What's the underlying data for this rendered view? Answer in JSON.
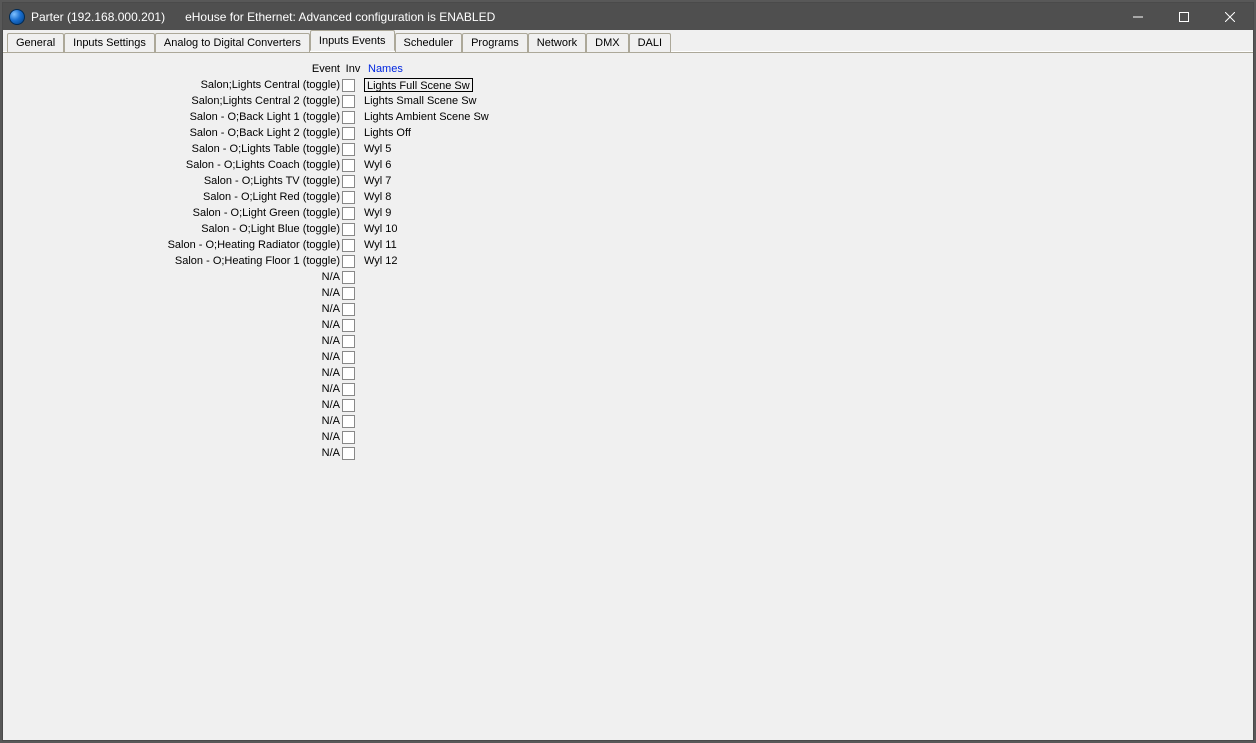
{
  "window": {
    "title": "Parter (192.168.000.201)      eHouse for Ethernet: Advanced configuration is ENABLED"
  },
  "tabs": [
    "General",
    "Inputs Settings",
    "Analog to Digital Converters",
    "Inputs Events",
    "Scheduler",
    "Programs",
    "Network",
    "DMX",
    "DALI"
  ],
  "active_tab_index": 3,
  "headers": {
    "event": "Event",
    "inv": "Inv",
    "names": "Names"
  },
  "rows": [
    {
      "event": "Salon;Lights Central (toggle)",
      "inv": false,
      "name": "Lights Full Scene Sw",
      "edit": true
    },
    {
      "event": "Salon;Lights Central 2 (toggle)",
      "inv": false,
      "name": "Lights Small Scene Sw",
      "edit": false
    },
    {
      "event": "Salon - O;Back Light 1 (toggle)",
      "inv": false,
      "name": "Lights Ambient Scene Sw",
      "edit": false
    },
    {
      "event": "Salon - O;Back Light 2 (toggle)",
      "inv": false,
      "name": "Lights Off",
      "edit": false
    },
    {
      "event": "Salon - O;Lights Table (toggle)",
      "inv": false,
      "name": "Wyl 5",
      "edit": false
    },
    {
      "event": "Salon - O;Lights Coach (toggle)",
      "inv": false,
      "name": "Wyl 6",
      "edit": false
    },
    {
      "event": "Salon - O;Lights TV (toggle)",
      "inv": false,
      "name": "Wyl 7",
      "edit": false
    },
    {
      "event": "Salon - O;Light Red (toggle)",
      "inv": false,
      "name": "Wyl 8",
      "edit": false
    },
    {
      "event": "Salon - O;Light Green (toggle)",
      "inv": false,
      "name": "Wyl 9",
      "edit": false
    },
    {
      "event": "Salon - O;Light Blue (toggle)",
      "inv": false,
      "name": "Wyl 10",
      "edit": false
    },
    {
      "event": "Salon - O;Heating Radiator (toggle)",
      "inv": false,
      "name": "Wyl 11",
      "edit": false
    },
    {
      "event": "Salon - O;Heating Floor 1 (toggle)",
      "inv": false,
      "name": "Wyl 12",
      "edit": false
    },
    {
      "event": "N/A",
      "inv": false,
      "name": "",
      "edit": false
    },
    {
      "event": "N/A",
      "inv": false,
      "name": "",
      "edit": false
    },
    {
      "event": "N/A",
      "inv": false,
      "name": "",
      "edit": false
    },
    {
      "event": "N/A",
      "inv": false,
      "name": "",
      "edit": false
    },
    {
      "event": "N/A",
      "inv": false,
      "name": "",
      "edit": false
    },
    {
      "event": "N/A",
      "inv": false,
      "name": "",
      "edit": false
    },
    {
      "event": "N/A",
      "inv": false,
      "name": "",
      "edit": false
    },
    {
      "event": "N/A",
      "inv": false,
      "name": "",
      "edit": false
    },
    {
      "event": "N/A",
      "inv": false,
      "name": "",
      "edit": false
    },
    {
      "event": "N/A",
      "inv": false,
      "name": "",
      "edit": false
    },
    {
      "event": "N/A",
      "inv": false,
      "name": "",
      "edit": false
    },
    {
      "event": "N/A",
      "inv": false,
      "name": "",
      "edit": false
    }
  ]
}
